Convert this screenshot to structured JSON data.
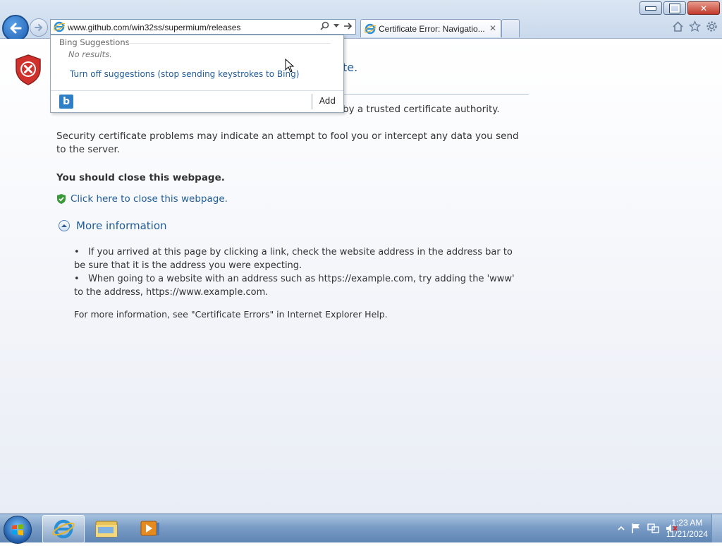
{
  "window": {
    "address_url": "www.github.com/win32ss/supermium/releases",
    "tab_title": "Certificate Error: Navigatio...",
    "tab_close": "✕",
    "minimize_label": "",
    "maximize_label": "",
    "close_label": "✕"
  },
  "address_dropdown": {
    "header": "Bing Suggestions",
    "no_results": "No results.",
    "turn_off_link": "Turn off suggestions (stop sending keystrokes to Bing)",
    "bing_logo": "b",
    "add_button": "Add"
  },
  "content": {
    "title_visible_fragment": "te.",
    "line_cert_authority": "by a trusted certificate authority.",
    "security_paragraph": "Security certificate problems may indicate an attempt to fool you or intercept any data you send to the server.",
    "recommendation": "You should close this webpage.",
    "close_link": "Click here to close this webpage.",
    "more_info_label": "More information",
    "bullets": [
      "If you arrived at this page by clicking a link, check the website address in the address bar to be sure that it is the address you were expecting.",
      "When going to a website with an address such as https://example.com, try adding the 'www' to the address, https://www.example.com."
    ],
    "help_text": "For more information, see \"Certificate Errors\" in Internet Explorer Help."
  },
  "taskbar": {
    "time": "1:23 AM",
    "date": "11/21/2024"
  },
  "colors": {
    "link": "#1f5c99",
    "error_red": "#d0312d",
    "shield_green": "#3a9a3a"
  }
}
